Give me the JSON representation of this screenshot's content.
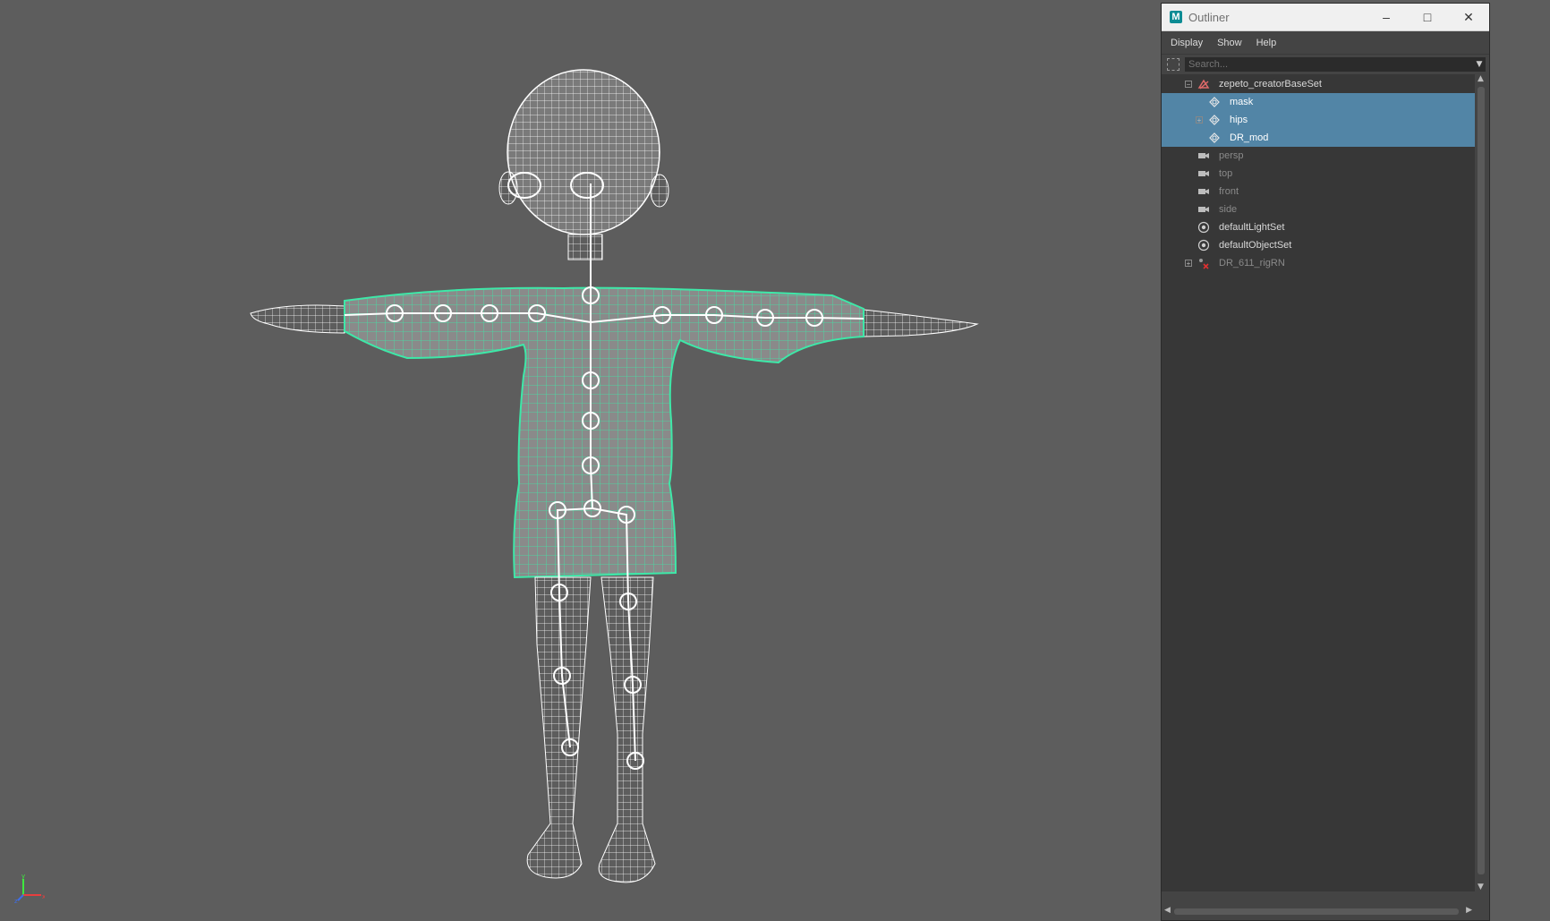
{
  "window": {
    "title": "Outliner",
    "app_icon_letter": "M",
    "minimize_glyph": "–",
    "maximize_glyph": "□",
    "close_glyph": "✕"
  },
  "menu": [
    "Display",
    "Show",
    "Help"
  ],
  "search": {
    "placeholder": "Search..."
  },
  "tree": [
    {
      "label": "zepeto_creatorBaseSet",
      "icon": "set-icon",
      "state": "normal",
      "expander": "minus"
    },
    {
      "label": "mask",
      "icon": "joint-icon",
      "state": "selected",
      "expander": "none"
    },
    {
      "label": "hips",
      "icon": "joint-icon",
      "state": "selected",
      "expander": "plus"
    },
    {
      "label": "DR_mod",
      "icon": "joint-icon",
      "state": "selected",
      "expander": "none"
    },
    {
      "label": "persp",
      "icon": "camera-icon",
      "state": "dim",
      "expander": "none"
    },
    {
      "label": "top",
      "icon": "camera-icon",
      "state": "dim",
      "expander": "none"
    },
    {
      "label": "front",
      "icon": "camera-icon",
      "state": "dim",
      "expander": "none"
    },
    {
      "label": "side",
      "icon": "camera-icon",
      "state": "dim",
      "expander": "none"
    },
    {
      "label": "defaultLightSet",
      "icon": "objectset-icon",
      "state": "normal",
      "expander": "none"
    },
    {
      "label": "defaultObjectSet",
      "icon": "objectset-icon",
      "state": "normal",
      "expander": "none"
    },
    {
      "label": "DR_611_rigRN",
      "icon": "reference-icon",
      "state": "dim",
      "expander": "plus"
    }
  ],
  "viewport": {
    "axes": {
      "x": "x",
      "y": "y",
      "z": "z"
    },
    "colors": {
      "background": "#5d5d5d",
      "wireframe": "#ffffff",
      "selected_mesh": "#3ee8a8",
      "selection": "#5285a6"
    }
  }
}
